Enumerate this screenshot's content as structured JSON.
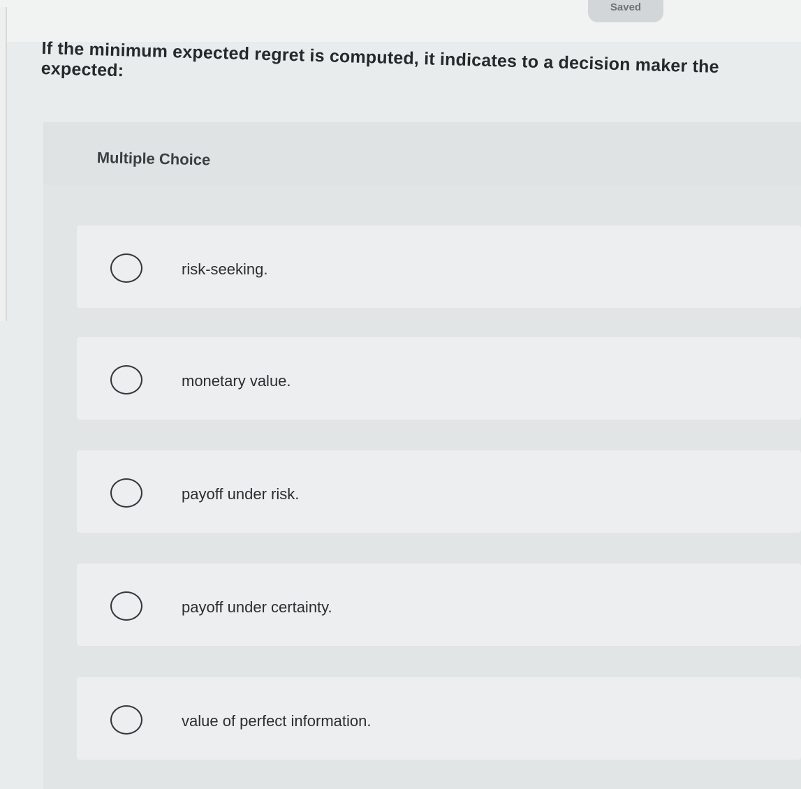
{
  "status": {
    "saved_label": "Saved"
  },
  "question": {
    "text": "If the minimum expected regret is computed, it indicates to a decision maker the expected:"
  },
  "multiple_choice": {
    "heading": "Multiple Choice",
    "options": [
      {
        "label": "risk-seeking."
      },
      {
        "label": "monetary value."
      },
      {
        "label": "payoff under risk."
      },
      {
        "label": "payoff under certainty."
      },
      {
        "label": "value of perfect information."
      }
    ]
  }
}
